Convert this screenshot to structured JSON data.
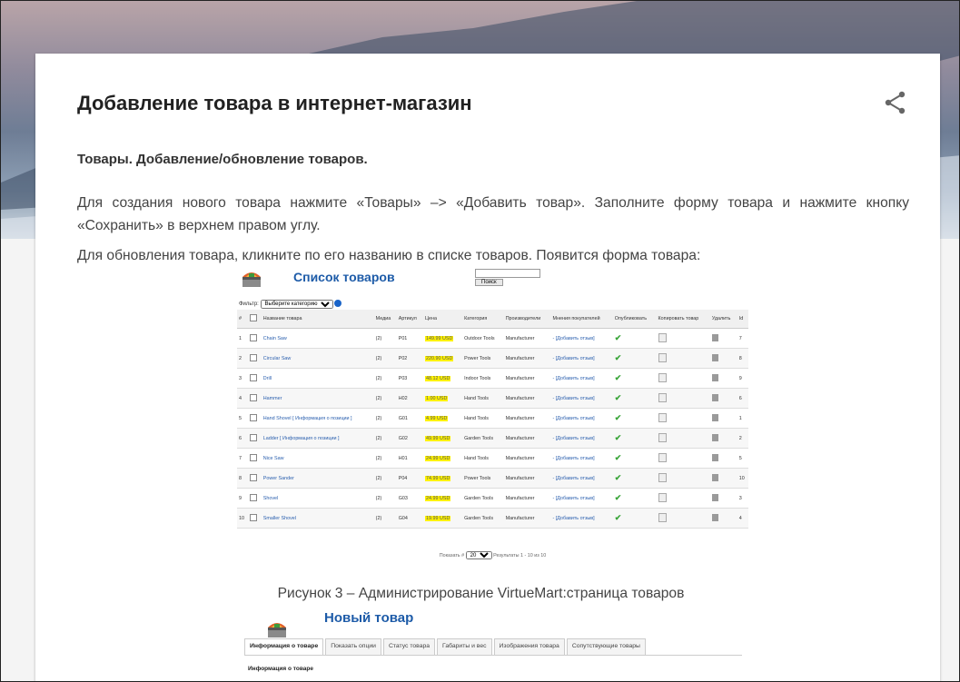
{
  "article": {
    "title": "Добавление товара в интернет-магазин",
    "subtitle": "Товары. Добавление/обновление товаров.",
    "para1": "Для создания нового товара нажмите «Товары» –> «Добавить товар». Заполните форму товара и нажмите кнопку «Сохранить» в верхнем правом углу.",
    "para2": "Для обновления товара, кликните по его названию в списке товаров. Появится форма товара:",
    "caption": "Рисунок 3 – Администрирование VirtueMart:страница товаров"
  },
  "shot1": {
    "heading": "Список товаров",
    "search_button": "Поиск",
    "filter_label": "Фильтр:",
    "filter_select": "Выберите категорию",
    "columns": [
      "#",
      "",
      "Название товара",
      "Медиа",
      "Артикул",
      "Цена",
      "Категория",
      "Производители",
      "Мнения покупателей",
      "Опубликовать",
      "Копировать товар",
      "Удалить",
      "Id"
    ],
    "rows": [
      {
        "n": "1",
        "name": "Chain Saw",
        "media": "(2)",
        "sku": "P01",
        "price": "149.99 USD",
        "cat": "Outdoor Tools",
        "mfr": "Manufacturer",
        "review": "- [Добавить отзыв]",
        "id": "7"
      },
      {
        "n": "2",
        "name": "Circular Saw",
        "media": "(2)",
        "sku": "P02",
        "price": "220.90 USD",
        "cat": "Power Tools",
        "mfr": "Manufacturer",
        "review": "- [Добавить отзыв]",
        "id": "8"
      },
      {
        "n": "3",
        "name": "Drill",
        "media": "(2)",
        "sku": "P03",
        "price": "48.12 USD",
        "cat": "Indoor Tools",
        "mfr": "Manufacturer",
        "review": "- [Добавить отзыв]",
        "id": "9"
      },
      {
        "n": "4",
        "name": "Hammer",
        "media": "(2)",
        "sku": "H02",
        "price": "1.00 USD",
        "cat": "Hand Tools",
        "mfr": "Manufacturer",
        "review": "- [Добавить отзыв]",
        "id": "6"
      },
      {
        "n": "5",
        "name": "Hand Shovel [ Информация о позиции ]",
        "media": "(2)",
        "sku": "G01",
        "price": "4.99 USD",
        "cat": "Hand Tools",
        "mfr": "Manufacturer",
        "review": "- [Добавить отзыв]",
        "id": "1"
      },
      {
        "n": "6",
        "name": "Ladder [ Информация о позиции ]",
        "media": "(2)",
        "sku": "G02",
        "price": "49.99 USD",
        "cat": "Garden Tools",
        "mfr": "Manufacturer",
        "review": "- [Добавить отзыв]",
        "id": "2"
      },
      {
        "n": "7",
        "name": "Nice Saw",
        "media": "(2)",
        "sku": "H01",
        "price": "24.99 USD",
        "cat": "Hand Tools",
        "mfr": "Manufacturer",
        "review": "- [Добавить отзыв]",
        "id": "5"
      },
      {
        "n": "8",
        "name": "Power Sander",
        "media": "(2)",
        "sku": "P04",
        "price": "74.99 USD",
        "cat": "Power Tools",
        "mfr": "Manufacturer",
        "review": "- [Добавить отзыв]",
        "id": "10"
      },
      {
        "n": "9",
        "name": "Shovel",
        "media": "(2)",
        "sku": "G03",
        "price": "24.99 USD",
        "cat": "Garden Tools",
        "mfr": "Manufacturer",
        "review": "- [Добавить отзыв]",
        "id": "3"
      },
      {
        "n": "10",
        "name": "Smaller Shovel",
        "media": "(2)",
        "sku": "G04",
        "price": "19.99 USD",
        "cat": "Garden Tools",
        "mfr": "Manufacturer",
        "review": "- [Добавить отзыв]",
        "id": "4"
      }
    ],
    "pager_label": "Показать #",
    "pager_value": "20",
    "pager_results": "Результаты 1 - 10 из 10"
  },
  "shot2": {
    "heading": "Новый товар",
    "tabs": [
      "Информация о товаре",
      "Показать опции",
      "Статус товара",
      "Габариты и вес",
      "Изображения товара",
      "Сопутствующие товары"
    ],
    "section": "Информация о товаре"
  },
  "colors": {
    "link": "#2a5fae",
    "heading_blue": "#1d5ba8",
    "price_highlight": "#fff200"
  }
}
